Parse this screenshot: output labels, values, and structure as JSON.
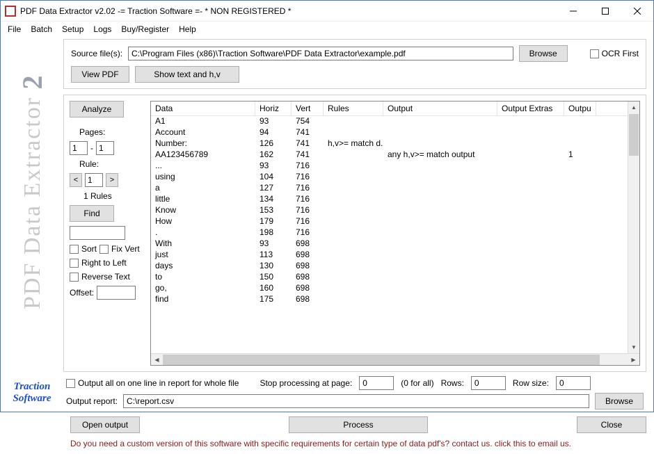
{
  "title": "PDF Data Extractor v2.02  -= Traction Software =- * NON REGISTERED *",
  "menus": [
    "File",
    "Batch",
    "Setup",
    "Logs",
    "Buy/Register",
    "Help"
  ],
  "logo": {
    "text": "PDF Data Extractor",
    "suffix": "2",
    "brand1": "Traction",
    "brand2": "Software"
  },
  "source": {
    "label": "Source file(s):",
    "path": "C:\\Program Files (x86)\\Traction Software\\PDF Data Extractor\\example.pdf",
    "browse": "Browse",
    "ocr": "OCR First",
    "view": "View PDF",
    "showtext": "Show text and h,v"
  },
  "side": {
    "analyze": "Analyze",
    "pages_label": "Pages:",
    "page_from": "1",
    "page_sep": "-",
    "page_to": "1",
    "rule_label": "Rule:",
    "rule_value": "1",
    "rules_count": "1 Rules",
    "find": "Find",
    "sort": "Sort",
    "fixvert": "Fix Vert",
    "rtl": "Right to Left",
    "reverse": "Reverse Text",
    "offset_label": "Offset:"
  },
  "table": {
    "headers": [
      "Data",
      "Horiz",
      "Vert",
      "Rules",
      "Output",
      "Output Extras",
      "Outpu"
    ],
    "rows": [
      {
        "data": "A1",
        "horiz": "93",
        "vert": "754",
        "rules": "",
        "output": "",
        "extras": "",
        "outp": ""
      },
      {
        "data": "Account",
        "horiz": "94",
        "vert": "741",
        "rules": "",
        "output": "",
        "extras": "",
        "outp": ""
      },
      {
        "data": "Number:",
        "horiz": "126",
        "vert": "741",
        "rules": "h,v>= match d...",
        "output": "",
        "extras": "",
        "outp": ""
      },
      {
        "data": "AA123456789",
        "horiz": "162",
        "vert": "741",
        "rules": "",
        "output": "any h,v>= match output",
        "extras": "",
        "outp": "1"
      },
      {
        "data": "...",
        "horiz": "93",
        "vert": "716",
        "rules": "",
        "output": "",
        "extras": "",
        "outp": ""
      },
      {
        "data": "using",
        "horiz": "104",
        "vert": "716",
        "rules": "",
        "output": "",
        "extras": "",
        "outp": ""
      },
      {
        "data": "a",
        "horiz": "127",
        "vert": "716",
        "rules": "",
        "output": "",
        "extras": "",
        "outp": ""
      },
      {
        "data": "little",
        "horiz": "134",
        "vert": "716",
        "rules": "",
        "output": "",
        "extras": "",
        "outp": ""
      },
      {
        "data": "Know",
        "horiz": "153",
        "vert": "716",
        "rules": "",
        "output": "",
        "extras": "",
        "outp": ""
      },
      {
        "data": "How",
        "horiz": "179",
        "vert": "716",
        "rules": "",
        "output": "",
        "extras": "",
        "outp": ""
      },
      {
        "data": ".",
        "horiz": "198",
        "vert": "716",
        "rules": "",
        "output": "",
        "extras": "",
        "outp": ""
      },
      {
        "data": "With",
        "horiz": "93",
        "vert": "698",
        "rules": "",
        "output": "",
        "extras": "",
        "outp": ""
      },
      {
        "data": "just",
        "horiz": "113",
        "vert": "698",
        "rules": "",
        "output": "",
        "extras": "",
        "outp": ""
      },
      {
        "data": "days",
        "horiz": "130",
        "vert": "698",
        "rules": "",
        "output": "",
        "extras": "",
        "outp": ""
      },
      {
        "data": "to",
        "horiz": "150",
        "vert": "698",
        "rules": "",
        "output": "",
        "extras": "",
        "outp": ""
      },
      {
        "data": "go,",
        "horiz": "160",
        "vert": "698",
        "rules": "",
        "output": "",
        "extras": "",
        "outp": ""
      },
      {
        "data": "find",
        "horiz": "175",
        "vert": "698",
        "rules": "",
        "output": "",
        "extras": "",
        "outp": ""
      }
    ]
  },
  "below": {
    "output_all": "Output all on one line in report for whole file",
    "stop_label": "Stop processing at page:",
    "stop_value": "0",
    "for_all": "(0 for all)",
    "rows_label": "Rows:",
    "rows_value": "0",
    "rowsize_label": "Row size:",
    "rowsize_value": "0"
  },
  "report": {
    "label": "Output report:",
    "path": "C:\\report.csv",
    "browse": "Browse"
  },
  "buttons": {
    "open": "Open output",
    "process": "Process",
    "close": "Close"
  },
  "footer": "Do you need a custom version of this software with specific requirements for certain type of data pdf's? contact us. click this to email us."
}
